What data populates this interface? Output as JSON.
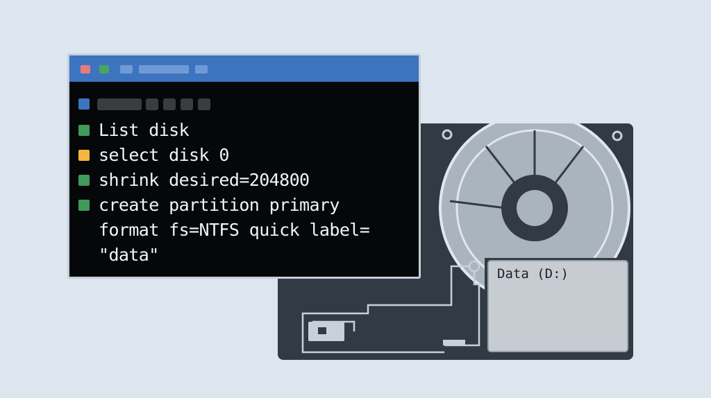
{
  "drive": {
    "label": "Data (D:)"
  },
  "terminal": {
    "commands": [
      {
        "text": "List disk",
        "status": "ok"
      },
      {
        "text": "select disk 0",
        "status": "warn"
      },
      {
        "text": "shrink desired=204800",
        "status": "ok"
      },
      {
        "text": "create partition primary",
        "status": "ok"
      },
      {
        "text": "format fs=NTFS quick label=",
        "status": "none"
      },
      {
        "text": "\"data\"",
        "status": "none"
      }
    ]
  },
  "colors": {
    "ok": "#3f9a5b",
    "warn": "#f4b63c",
    "info": "#3c74bf",
    "close": "#e47c7c",
    "max": "#46a55e"
  }
}
